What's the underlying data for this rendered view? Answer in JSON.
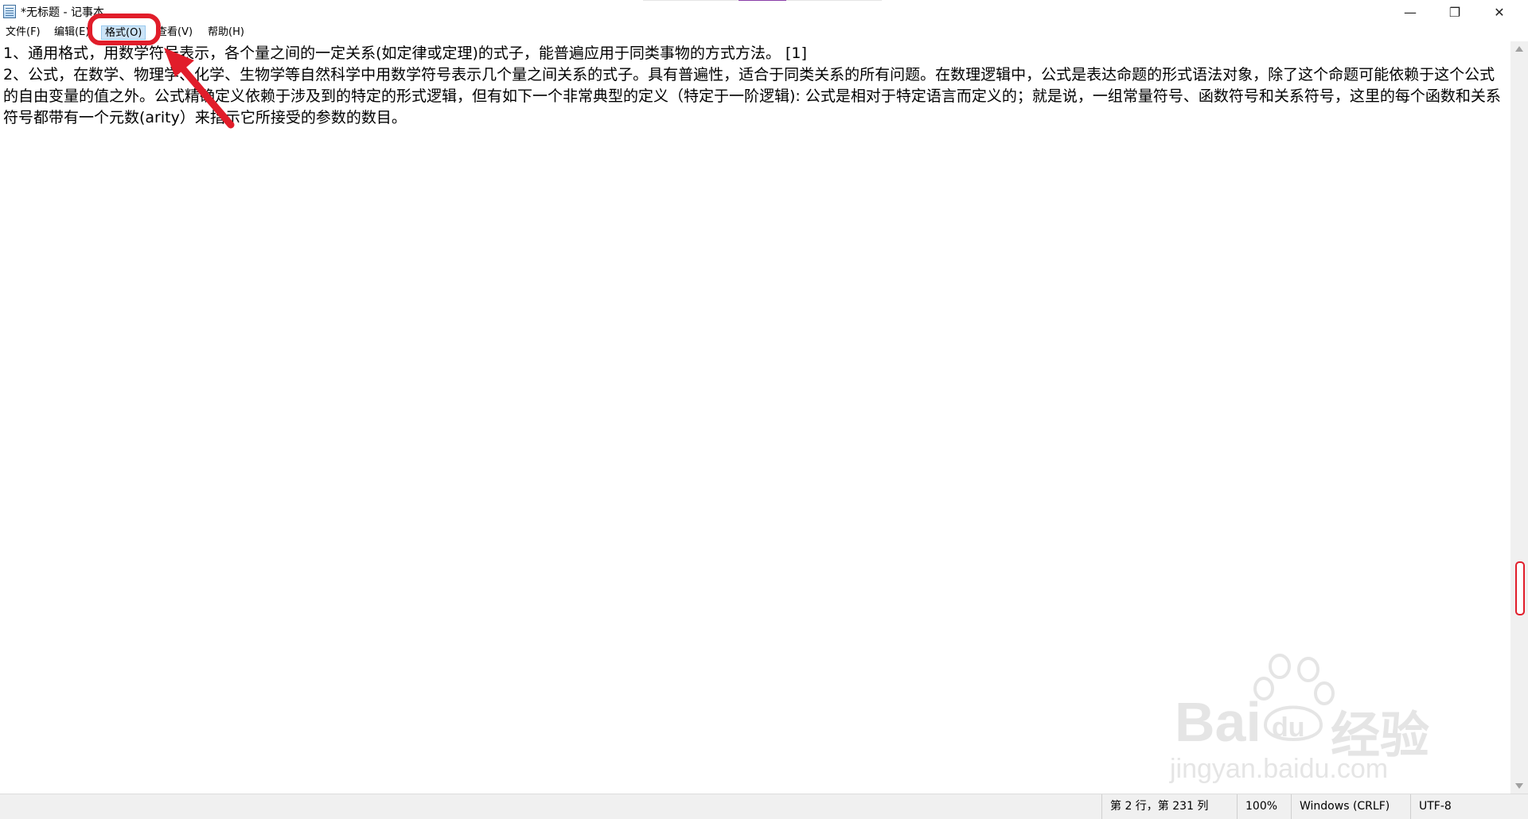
{
  "window": {
    "title": "*无标题 - 记事本",
    "minimize_glyph": "—",
    "maximize_glyph": "❐",
    "close_glyph": "✕"
  },
  "menu": {
    "file": "文件(F)",
    "edit": "编辑(E)",
    "format": "格式(O)",
    "view": "查看(V)",
    "help": "帮助(H)",
    "highlighted": "format"
  },
  "editor": {
    "content": "1、通用格式，用数学符号表示，各个量之间的一定关系(如定律或定理)的式子，能普遍应用于同类事物的方式方法。 [1]\n2、公式，在数学、物理学、化学、生物学等自然科学中用数学符号表示几个量之间关系的式子。具有普遍性，适合于同类关系的所有问题。在数理逻辑中，公式是表达命题的形式语法对象，除了这个命题可能依赖于这个公式的自由变量的值之外。公式精确定义依赖于涉及到的特定的形式逻辑，但有如下一个非常典型的定义（特定于一阶逻辑): 公式是相对于特定语言而定义的；就是说，一组常量符号、函数符号和关系符号，这里的每个函数和关系符号都带有一个元数(arity）来指示它所接受的参数的数目。"
  },
  "status": {
    "position": "第 2 行，第 231 列",
    "zoom": "100%",
    "line_ending": "Windows (CRLF)",
    "encoding": "UTF-8"
  },
  "watermark": {
    "brand": "Bai",
    "paw_text": "du",
    "cn": "经验",
    "url": "jingyan.baidu.com"
  },
  "colors": {
    "annotation_red": "#e11d2a",
    "menu_highlight": "#cce4f7"
  },
  "icons": {
    "app": "notepad-icon",
    "scroll_up": "scroll-up-arrow-icon",
    "scroll_down": "scroll-down-arrow-icon"
  }
}
